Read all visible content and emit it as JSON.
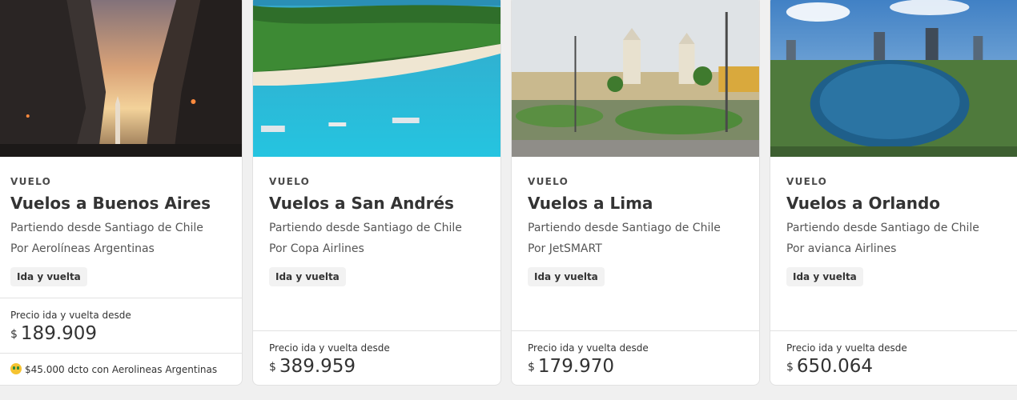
{
  "cards": [
    {
      "tag": "VUELO",
      "title": "Vuelos a Buenos Aires",
      "origin": "Partiendo desde Santiago de Chile",
      "airline": "Por Aerolíneas Argentinas",
      "trip_type": "Ida y vuelta",
      "price_label": "Precio ida y vuelta desde",
      "currency": "$",
      "price": "189.909",
      "promo_icon": "money-face-icon",
      "promo": "$45.000 dcto con Aerolineas Argentinas"
    },
    {
      "tag": "VUELO",
      "title": "Vuelos a San Andrés",
      "origin": "Partiendo desde Santiago de Chile",
      "airline": "Por Copa Airlines",
      "trip_type": "Ida y vuelta",
      "price_label": "Precio ida y vuelta desde",
      "currency": "$",
      "price": "389.959"
    },
    {
      "tag": "VUELO",
      "title": "Vuelos a Lima",
      "origin": "Partiendo desde Santiago de Chile",
      "airline": "Por JetSMART",
      "trip_type": "Ida y vuelta",
      "price_label": "Precio ida y vuelta desde",
      "currency": "$",
      "price": "179.970"
    },
    {
      "tag": "VUELO",
      "title": "Vuelos a Orlando",
      "origin": "Partiendo desde Santiago de Chile",
      "airline": "Por avianca Airlines",
      "trip_type": "Ida y vuelta",
      "price_label": "Precio ida y vuelta desde",
      "currency": "$",
      "price": "650.064"
    }
  ],
  "colors": {
    "page_background": "#f0f0f0",
    "card_background": "#ffffff",
    "border": "#e1e1e1",
    "chip_background": "#f2f2f2",
    "text": "#333333"
  }
}
